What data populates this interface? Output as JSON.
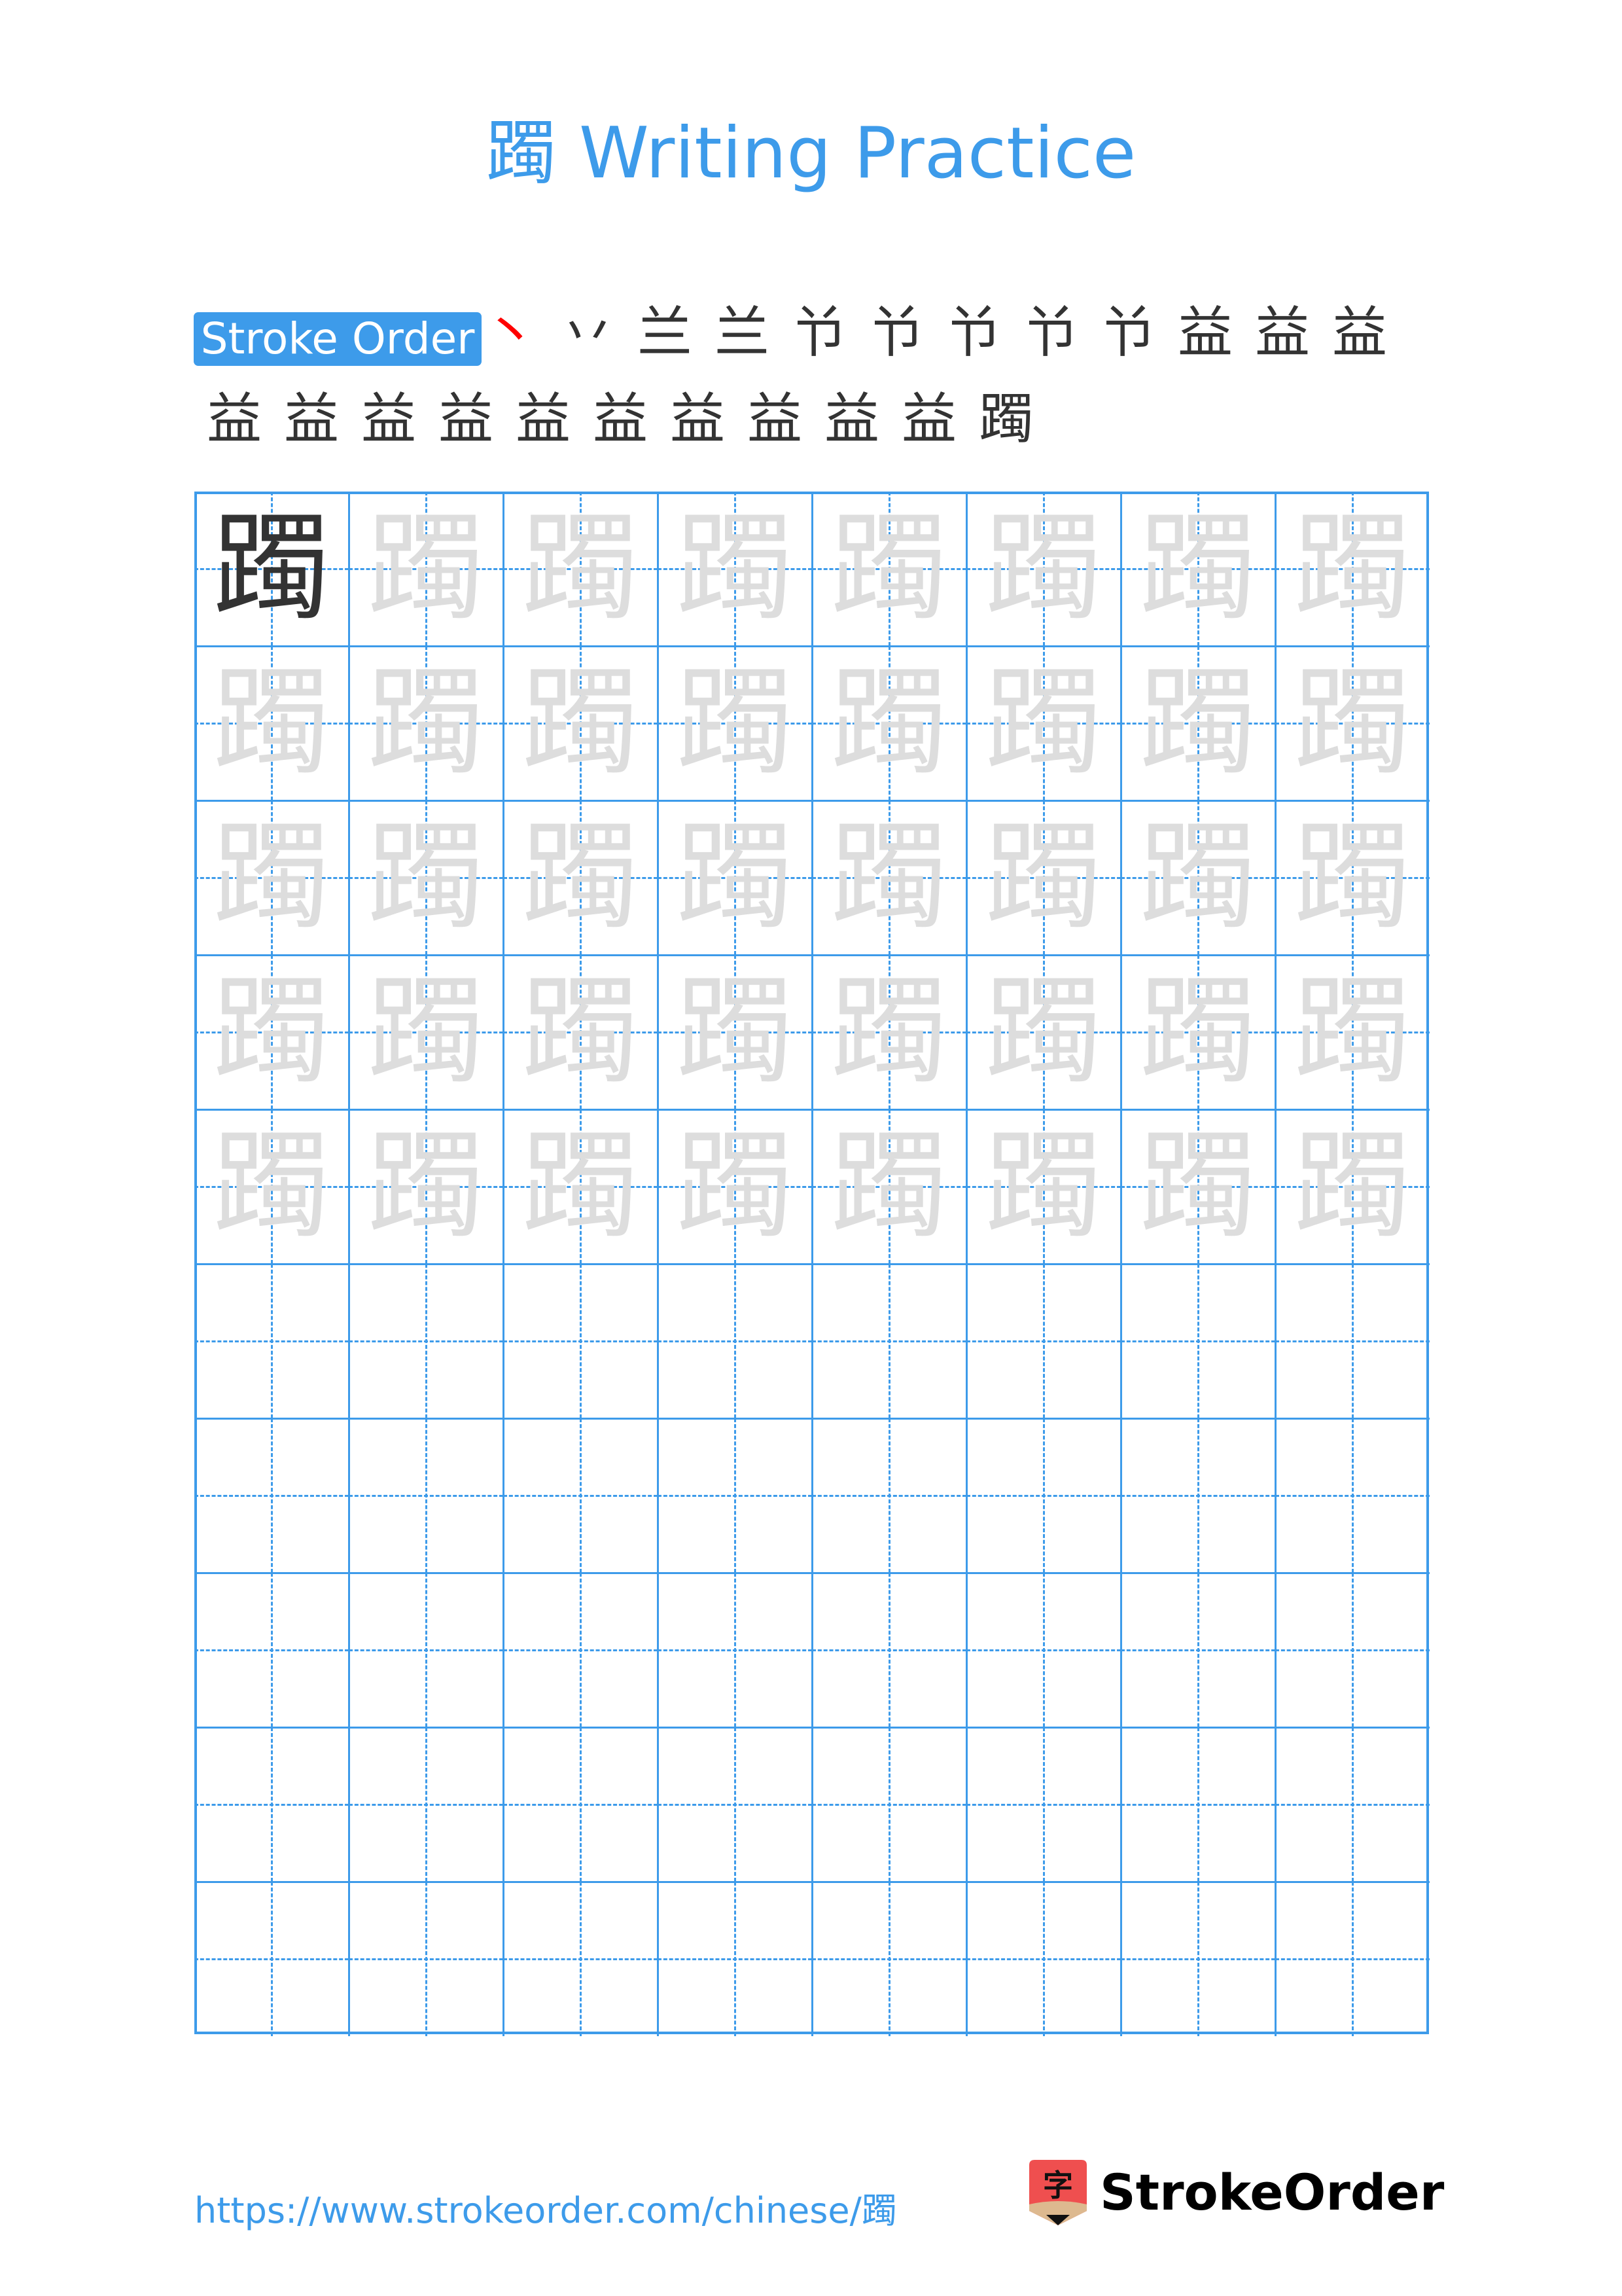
{
  "page": {
    "title": "躅 Writing Practice",
    "character": "躅"
  },
  "stroke_order": {
    "badge_label": "Stroke Order",
    "total_strokes": 23,
    "steps": [
      {
        "base": "",
        "new": "丶"
      },
      {
        "base": "丶",
        "new": "丿"
      },
      {
        "base": "丷",
        "new": "一"
      },
      {
        "base": "兰",
        "new": "丿"
      },
      {
        "base": "兰",
        "new": "丶"
      },
      {
        "base": "兯",
        "new": "丨"
      },
      {
        "base": "兯",
        "new": "𠃌"
      },
      {
        "base": "兯",
        "new": "丨"
      },
      {
        "base": "兯",
        "new": "丨"
      },
      {
        "base": "益",
        "new": "一"
      },
      {
        "base": "益",
        "new": "丨"
      },
      {
        "base": "益",
        "new": "𠃌"
      },
      {
        "base": "益",
        "new": "丨"
      },
      {
        "base": "益",
        "new": "丨"
      },
      {
        "base": "益罒",
        "new": "一"
      },
      {
        "base": "益罒",
        "new": "丿"
      },
      {
        "base": "益罒",
        "new": "𠃌"
      },
      {
        "base": "益罒",
        "new": "丨"
      },
      {
        "base": "益罒",
        "new": "一"
      },
      {
        "base": "益罒",
        "new": "丨"
      },
      {
        "base": "益罒",
        "new": "一"
      },
      {
        "base": "益罒",
        "new": "丶"
      },
      {
        "base": "躅",
        "new": ""
      }
    ],
    "step_glyphs": [
      "丶",
      "丷",
      "兰",
      "兰",
      "兯",
      "兯",
      "兯",
      "兯",
      "兯",
      "益",
      "益",
      "益",
      "益",
      "益",
      "益",
      "益",
      "益",
      "益",
      "益",
      "益",
      "益",
      "益",
      "躅"
    ],
    "highlight_color": "#ff0000"
  },
  "practice_grid": {
    "rows": 10,
    "columns": 8,
    "model_character": "躅",
    "trace_rows": 5,
    "line_color": "#3d9bea",
    "trace_color": "#dddddd",
    "model_color": "#333333"
  },
  "footer": {
    "url": "https://www.strokeorder.com/chinese/躅",
    "logo_text": "StrokeOrder",
    "logo_icon_char": "字"
  }
}
